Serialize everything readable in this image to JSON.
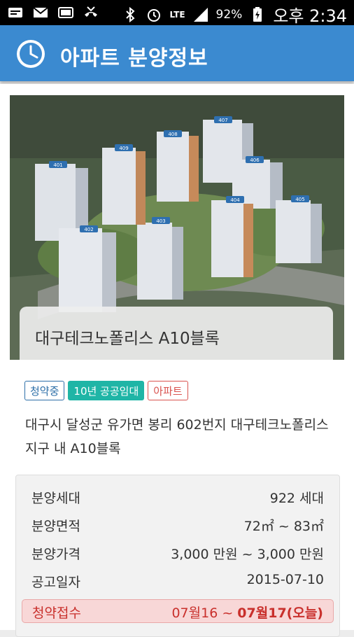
{
  "status_bar": {
    "battery_percent": "92%",
    "time": "오후 2:34",
    "network": "LTE"
  },
  "app": {
    "title": "아파트 분양정보"
  },
  "listing": {
    "name": "대구테크노폴리스 A10블록",
    "tags": [
      "청약중",
      "10년 공공임대",
      "아파트"
    ],
    "address": "대구시 달성군 유가면 봉리 602번지 대구테크노폴리스지구 내 A10블록",
    "building_numbers": [
      "401",
      "402",
      "403",
      "404",
      "405",
      "406",
      "407",
      "408",
      "409"
    ],
    "details": [
      {
        "label": "분양세대",
        "value": "922 세대"
      },
      {
        "label": "분양면적",
        "value": "72㎡ ~ 83㎡"
      },
      {
        "label": "분양가격",
        "value": "3,000 만원 ~ 3,000 만원"
      },
      {
        "label": "공고일자",
        "value": "2015-07-10"
      }
    ],
    "application": {
      "label": "청약접수",
      "start": "07월16",
      "separator": " ~ ",
      "end": "07월17(오늘)"
    }
  },
  "colors": {
    "app_bar": "#3b8ad0",
    "tag_blue": "#2d6fa8",
    "tag_teal": "#1fb5a6",
    "tag_red": "#d9534f",
    "highlight_text": "#c9302c"
  }
}
